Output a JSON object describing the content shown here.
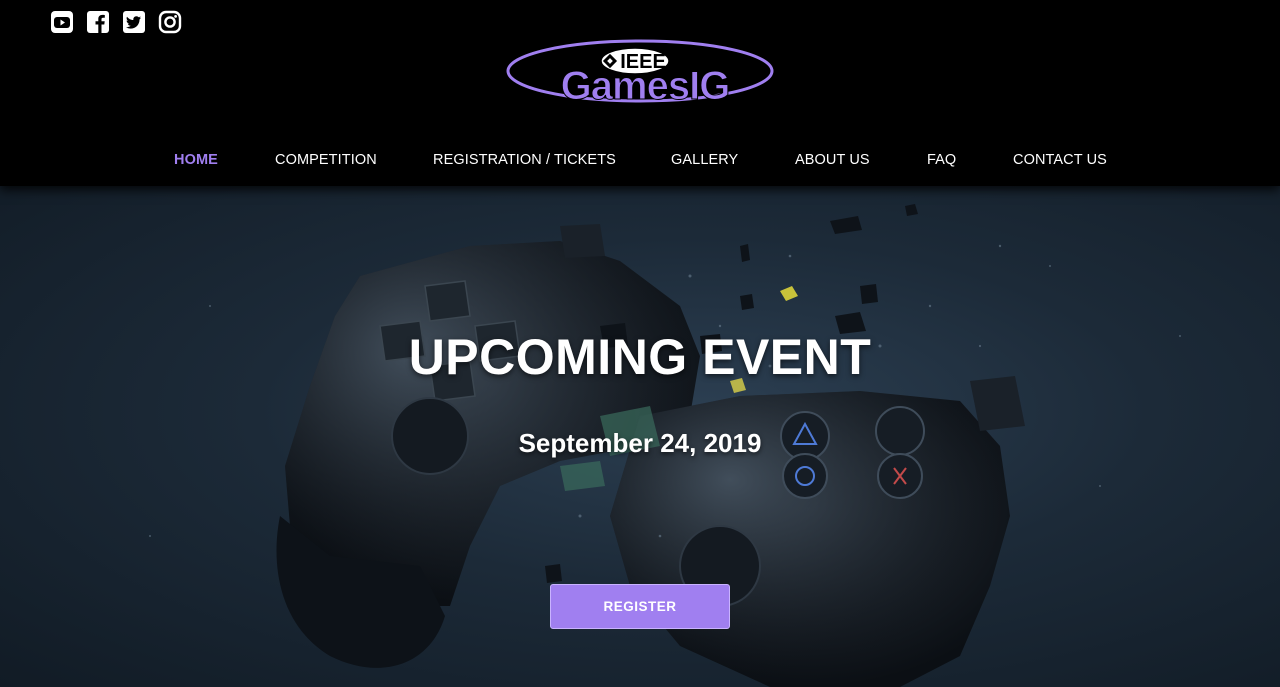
{
  "social": [
    {
      "name": "youtube-icon"
    },
    {
      "name": "facebook-icon"
    },
    {
      "name": "twitter-icon"
    },
    {
      "name": "instagram-icon"
    }
  ],
  "logo": {
    "top_text": "IEEE",
    "main_text": "GamesIG"
  },
  "nav": {
    "items": [
      {
        "label": "HOME",
        "active": true
      },
      {
        "label": "COMPETITION",
        "active": false
      },
      {
        "label": "REGISTRATION / TICKETS",
        "active": false
      },
      {
        "label": "GALLERY",
        "active": false
      },
      {
        "label": "ABOUT US",
        "active": false
      },
      {
        "label": "FAQ",
        "active": false
      },
      {
        "label": "CONTACT US",
        "active": false
      }
    ]
  },
  "hero": {
    "title": "UPCOMING EVENT",
    "date": "September 24, 2019",
    "button_label": "REGISTER"
  },
  "colors": {
    "accent": "#a07ff0",
    "background": "#000000",
    "text": "#ffffff"
  }
}
